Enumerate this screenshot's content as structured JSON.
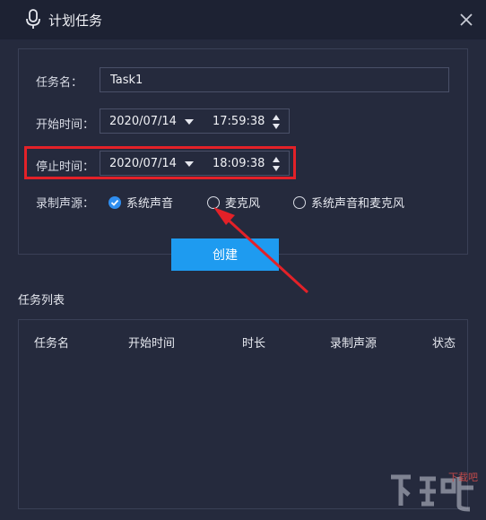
{
  "window": {
    "title": "计划任务",
    "icons": {
      "title": "microphone-icon",
      "close": "close-icon"
    }
  },
  "form": {
    "task_name_label": "任务名：",
    "task_name_value": "Task1",
    "start_label": "开始时间：",
    "start_date": "2020/07/14",
    "start_time": "17:59:38",
    "stop_label": "停止时间：",
    "stop_date": "2020/07/14",
    "stop_time": "18:09:38",
    "source_label": "录制声源：",
    "sources": [
      {
        "label": "系统声音",
        "selected": true
      },
      {
        "label": "麦克风",
        "selected": false
      },
      {
        "label": "系统声音和麦克风",
        "selected": false
      }
    ],
    "create_label": "创建"
  },
  "task_list": {
    "title": "任务列表",
    "columns": [
      "任务名",
      "开始时间",
      "时长",
      "录制声源",
      "状态"
    ]
  },
  "watermark": {
    "text": "下载吧"
  },
  "colors": {
    "accent": "#1e9bf0",
    "highlight": "#e32128",
    "bg": "#252a3d",
    "titlebar": "#1d2233"
  }
}
